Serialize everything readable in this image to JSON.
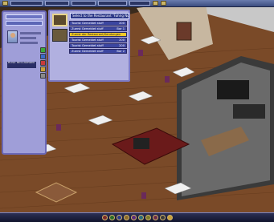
{
  "top_bar": {
    "fields": [
      "",
      "",
      "",
      "",
      ""
    ]
  },
  "left_panel": {
    "header": "",
    "name_tag": "ROSE RESTAURANT"
  },
  "dialog": {
    "title": "Select to the Restaurant \"Fahrig Noir\"",
    "rows": [
      {
        "label": "Tourist Gemeldet stuff",
        "end": "200"
      },
      {
        "label": "Zuerst Gemeldet stuff",
        "end": "Bar 1"
      },
      {
        "label": "Zuerst der Restaurant/Sendungen",
        "end": ""
      },
      {
        "label": "Tourist Gemeldet stuff",
        "end": "200"
      },
      {
        "label": "Tourist Gemeldet stuff",
        "end": "200"
      },
      {
        "label": "Zuerst Gemeldet stuff",
        "end": "Bar 2"
      }
    ]
  },
  "colors": {
    "panel": "#9f9ed8",
    "dialog_row_blue": "#3c46a0",
    "dialog_row_gold": "#f0c828",
    "floor": "#7a4a28"
  }
}
